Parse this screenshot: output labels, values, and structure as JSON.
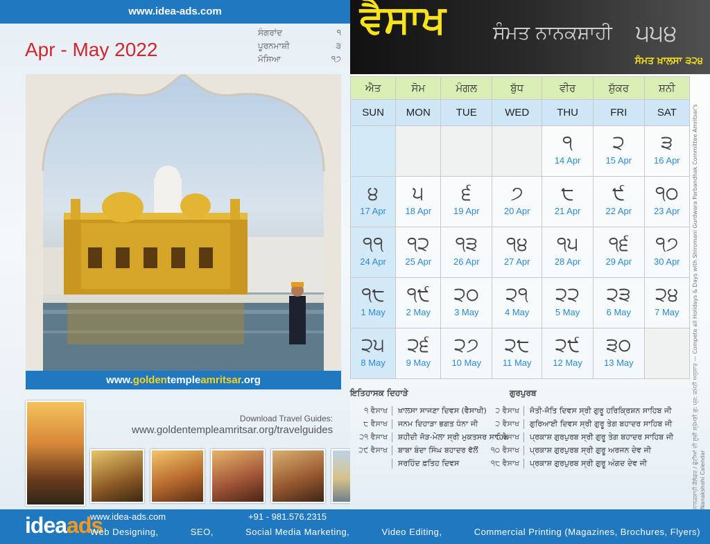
{
  "left": {
    "top_url": "www.idea-ads.com",
    "month_range": "Apr - May 2022",
    "key_dates": [
      {
        "label": "ਸੰਗਰਾਂਦ",
        "value": "੧"
      },
      {
        "label": "ਪੂਰਨਮਾਸ਼ੀ",
        "value": "੩"
      },
      {
        "label": "ਮੱਸਿਆ",
        "value": "੧੭"
      }
    ],
    "photo_caption": {
      "pre": "www.",
      "hl1": "golden",
      "mid": "temple",
      "hl2": "amritsar",
      "post": ".org"
    },
    "download_label": "Download Travel Guides:",
    "download_url": "www.goldentempleamritsar.org/travelguides"
  },
  "footer": {
    "logo_a": "idea",
    "logo_b": "ads",
    "url": "www.idea-ads.com",
    "phone": "+91 - 981.576.2315",
    "services": [
      "Web Designing,",
      "SEO,",
      "Social Media Marketing,",
      "Video Editing,",
      "Commercial Printing (Magazines, Brochures, Flyers)"
    ]
  },
  "header": {
    "month": "ਵੈਸਾਖ",
    "era_title": "ਸੰਮਤ ਨਾਨਕਸ਼ਾਹੀ",
    "era_year": "੫੫੪",
    "khalsa": "ਸੰਮਤ ਖ਼ਾਲਸਾ ੩੨੪"
  },
  "weekdays_pa": [
    "ਐਤ",
    "ਸੋਮ",
    "ਮੰਗਲ",
    "ਬੁੱਧ",
    "ਵੀਰ",
    "ਸ਼ੁੱਕਰ",
    "ਸ਼ਨੀ"
  ],
  "weekdays_en": [
    "SUN",
    "MON",
    "TUE",
    "WED",
    "THU",
    "FRI",
    "SAT"
  ],
  "weeks": [
    [
      null,
      null,
      null,
      null,
      {
        "n": "੧",
        "d": "14 Apr"
      },
      {
        "n": "੨",
        "d": "15 Apr"
      },
      {
        "n": "੩",
        "d": "16 Apr"
      }
    ],
    [
      {
        "n": "੪",
        "d": "17 Apr"
      },
      {
        "n": "੫",
        "d": "18 Apr"
      },
      {
        "n": "੬",
        "d": "19 Apr"
      },
      {
        "n": "੭",
        "d": "20 Apr"
      },
      {
        "n": "੮",
        "d": "21 Apr"
      },
      {
        "n": "੯",
        "d": "22 Apr"
      },
      {
        "n": "੧੦",
        "d": "23 Apr"
      }
    ],
    [
      {
        "n": "੧੧",
        "d": "24 Apr"
      },
      {
        "n": "੧੨",
        "d": "25 Apr"
      },
      {
        "n": "੧੩",
        "d": "26 Apr"
      },
      {
        "n": "੧੪",
        "d": "27 Apr"
      },
      {
        "n": "੧੫",
        "d": "28 Apr"
      },
      {
        "n": "੧੬",
        "d": "29 Apr"
      },
      {
        "n": "੧੭",
        "d": "30 Apr"
      }
    ],
    [
      {
        "n": "੧੮",
        "d": "1 May"
      },
      {
        "n": "੧੯",
        "d": "2 May"
      },
      {
        "n": "੨੦",
        "d": "3 May"
      },
      {
        "n": "੨੧",
        "d": "4 May"
      },
      {
        "n": "੨੨",
        "d": "5 May"
      },
      {
        "n": "੨੩",
        "d": "6 May"
      },
      {
        "n": "੨੪",
        "d": "7 May"
      }
    ],
    [
      {
        "n": "੨੫",
        "d": "8 May"
      },
      {
        "n": "੨੬",
        "d": "9 May"
      },
      {
        "n": "੨੭",
        "d": "10 May"
      },
      {
        "n": "੨੮",
        "d": "11 May"
      },
      {
        "n": "੨੯",
        "d": "12 May"
      },
      {
        "n": "੩੦",
        "d": "13 May"
      },
      null
    ]
  ],
  "history": {
    "title": "ਇਤਿਹਾਸਕ ਦਿਹਾੜੇ",
    "items": [
      {
        "date": "੧ ਵੈਸਾਖ",
        "text": "ਖ਼ਾਲਸਾ ਸਾਜਣਾ ਦਿਵਸ (ਵੈਸਾਖੀ)"
      },
      {
        "date": "੮ ਵੈਸਾਖ",
        "text": "ਜਨਮ ਦਿਹਾੜਾ ਭਗਤ ਧੰਨਾ ਜੀ"
      },
      {
        "date": "੨੧ ਵੈਸਾਖ",
        "text": "ਸ਼ਹੀਦੀ ਜੋੜ-ਮੇਲਾ ਸ੍ਰੀ ਮੁਕਤਸਰ ਸਾਹਿਬ"
      },
      {
        "date": "੨੯ ਵੈਸਾਖ",
        "text": "ਬਾਬਾ ਬੰਦਾ ਸਿੰਘ ਬਹਾਦਰ ਵੱਲੋਂ"
      },
      {
        "date": "",
        "text": "ਸਰਹਿੰਦ ਫ਼ਤਿਹ ਦਿਵਸ"
      }
    ]
  },
  "gurpurab": {
    "title": "ਗੁਰਪੁਰਬ",
    "items": [
      {
        "date": "੨ ਵੈਸਾਖ",
        "text": "ਜੋਤੀ-ਜੋਤਿ ਦਿਵਸ ਸ੍ਰੀ ਗੁਰੂ ਹਰਿਕ੍ਰਿਸ਼ਨ ਸਾਹਿਬ ਜੀ"
      },
      {
        "date": "੨ ਵੈਸਾਖ",
        "text": "ਗੁਰਿਆਈ ਦਿਵਸ ਸ੍ਰੀ ਗੁਰੂ ਤੇਗ ਬਹਾਦਰ ਸਾਹਿਬ ਜੀ"
      },
      {
        "date": "੮ ਵੈਸਾਖ",
        "text": "ਪ੍ਰਕਾਸ਼ ਗੁਰਪੁਰਬ ਸ੍ਰੀ ਗੁਰੂ ਤੇਗ ਬਹਾਦਰ ਸਾਹਿਬ ਜੀ"
      },
      {
        "date": "੧੦ ਵੈਸਾਖ",
        "text": "ਪ੍ਰਕਾਸ਼ ਗੁਰਪੁਰਬ ਸ੍ਰੀ ਗੁਰੂ ਅਰਜਨ ਦੇਵ ਜੀ"
      },
      {
        "date": "੧੮ ਵੈਸਾਖ",
        "text": "ਪ੍ਰਕਾਸ਼ ਗੁਰਪੁਰਬ ਸ੍ਰੀ ਗੁਰੂ ਅੰਗਦ ਦੇਵ ਜੀ"
      }
    ]
  },
  "side_note": "ਨਾਨਕਸ਼ਾਹੀ ਕੈਲੰਡਰ / ਛੁੱਟੀਆਂ ਦੀ ਸੂਚੀ ਸ਼੍ਰੋਮਣੀ ਗੁ: ਪ੍ਰ: ਕਮੇਟੀ ਅਨੁਸਾਰ — Compete all Holidays & Days with Shiromani Gurdwara Parbandhak Committee Amritsar's Nanakshahi Calendar"
}
